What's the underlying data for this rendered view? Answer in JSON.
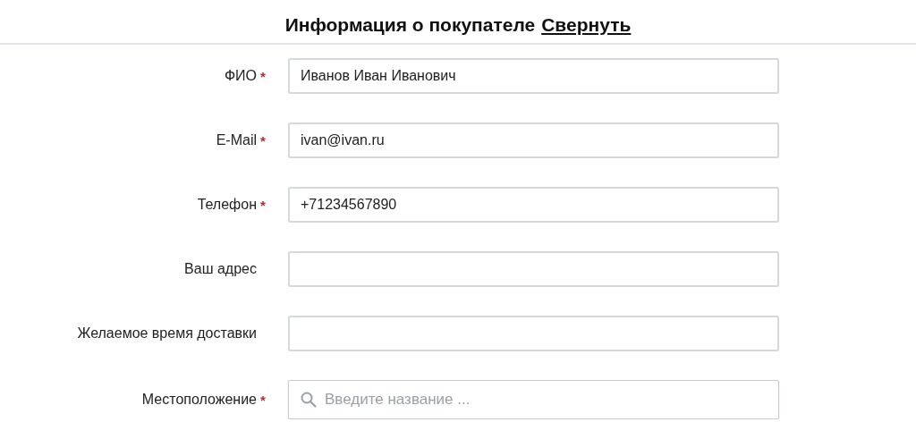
{
  "header": {
    "title": "Информация о покупателе",
    "link": "Свернуть"
  },
  "fields": [
    {
      "kind": "text",
      "label": "ФИО",
      "required_mark": "*",
      "value": "Иванов Иван Иванович"
    },
    {
      "kind": "text",
      "label": "E-Mail",
      "required_mark": "*",
      "value": "ivan@ivan.ru"
    },
    {
      "kind": "text",
      "label": "Телефон",
      "required_mark": "*",
      "value": "+71234567890"
    },
    {
      "kind": "text",
      "label": "Ваш адрес"
    },
    {
      "kind": "text",
      "label": "Желаемое время доставки"
    },
    {
      "kind": "search",
      "label": "Местоположение",
      "required_mark": "*",
      "placeholder": "Введите название ..."
    }
  ]
}
